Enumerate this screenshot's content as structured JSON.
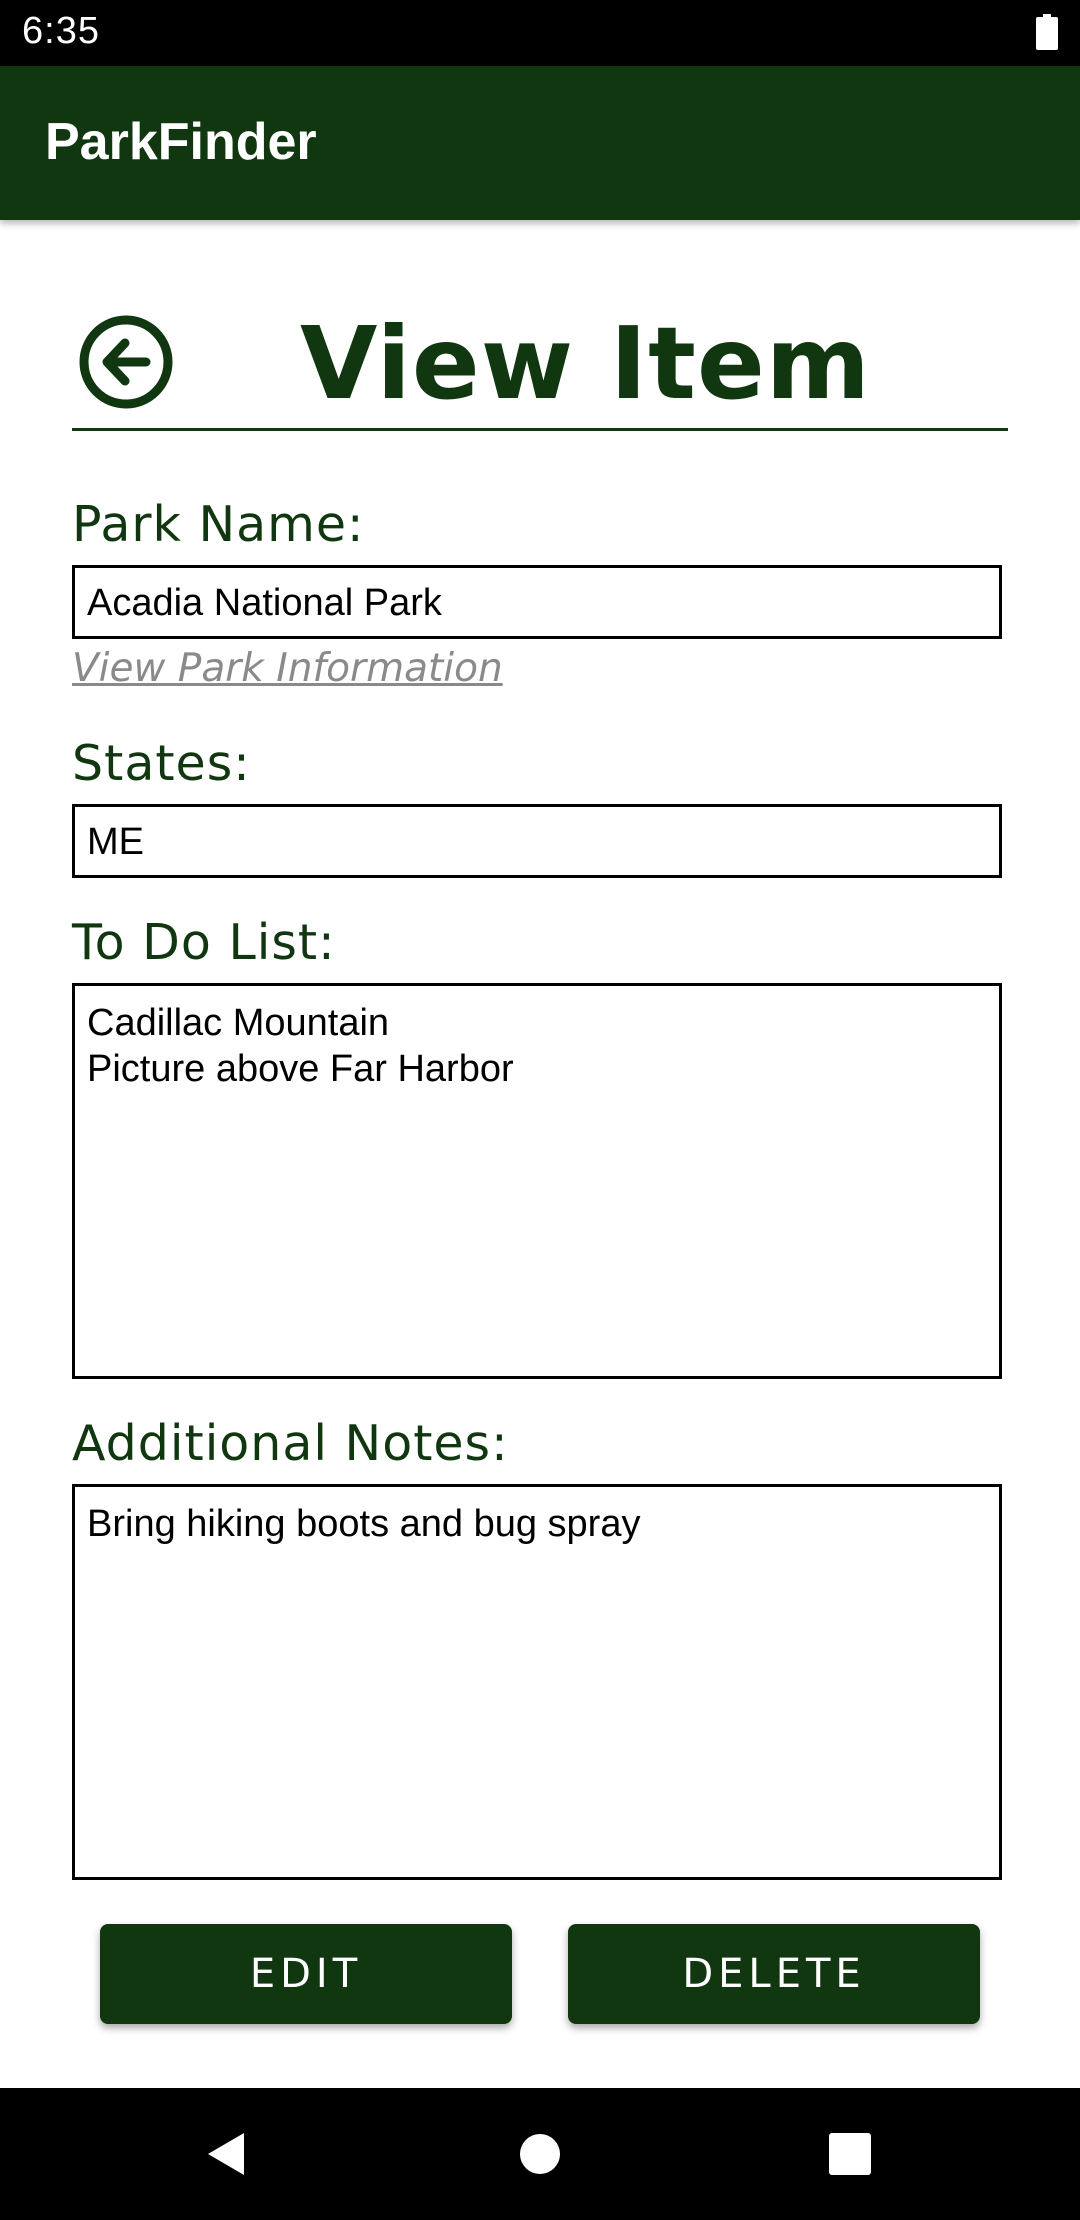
{
  "status_bar": {
    "time": "6:35",
    "battery_icon": "battery-full-icon"
  },
  "app_bar": {
    "title": "ParkFinder"
  },
  "header": {
    "back_icon": "back-arrow-circle-icon",
    "title": "View Item"
  },
  "form": {
    "park_name": {
      "label": "Park Name:",
      "value": "Acadia National Park"
    },
    "park_info_link": "View Park Information",
    "states": {
      "label": "States:",
      "value": "ME"
    },
    "todo": {
      "label": "To Do List:",
      "value": "Cadillac Mountain\nPicture above Far Harbor"
    },
    "notes": {
      "label": "Additional Notes:",
      "value": "Bring hiking boots and bug spray"
    }
  },
  "actions": {
    "edit_label": "EDIT",
    "delete_label": "DELETE"
  },
  "nav_bar": {
    "back_icon": "nav-back-icon",
    "home_icon": "nav-home-icon",
    "recents_icon": "nav-recents-icon"
  },
  "colors": {
    "primary": "#113710",
    "link": "#8a8a8a",
    "system_bars": "#000000"
  }
}
